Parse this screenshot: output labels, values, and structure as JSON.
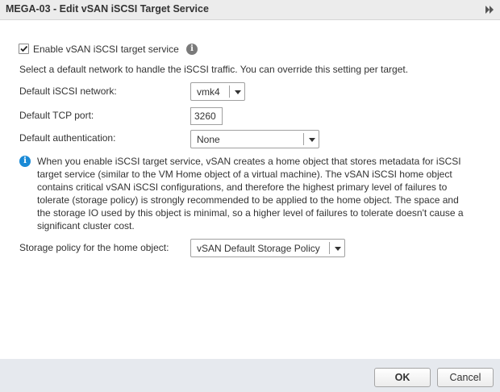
{
  "dialog": {
    "title": "MEGA-03 - Edit vSAN iSCSI Target Service"
  },
  "enable": {
    "label": "Enable vSAN iSCSI target service",
    "checked": true
  },
  "description": "Select a default network to handle the iSCSI traffic. You can override this setting per target.",
  "fields": {
    "network_label": "Default iSCSI network:",
    "network_value": "vmk4",
    "port_label": "Default TCP port:",
    "port_value": "3260",
    "auth_label": "Default authentication:",
    "auth_value": "None"
  },
  "info": {
    "text": "When you enable iSCSI target service, vSAN creates a home object that stores metadata for iSCSI target service (similar to the VM Home object of a virtual machine). The vSAN iSCSI home object contains critical vSAN iSCSI configurations, and therefore the highest primary level of failures to tolerate (storage policy) is strongly recommended to be applied to the home object. The space and the storage IO used by this object is minimal, so a higher level of failures to tolerate doesn't cause a significant cluster cost."
  },
  "policy": {
    "label": "Storage policy for the home object:",
    "value": "vSAN Default Storage Policy"
  },
  "buttons": {
    "ok": "OK",
    "cancel": "Cancel"
  },
  "icons": {
    "expand": "double-chevron-right-icon",
    "info": "info-icon",
    "checkmark": "checkmark-icon",
    "dropdown": "caret-down-icon"
  },
  "colors": {
    "info_blue": "#1a8ad6",
    "footer_bg": "#e6e9ee",
    "titlebar_bg": "#ececec"
  }
}
